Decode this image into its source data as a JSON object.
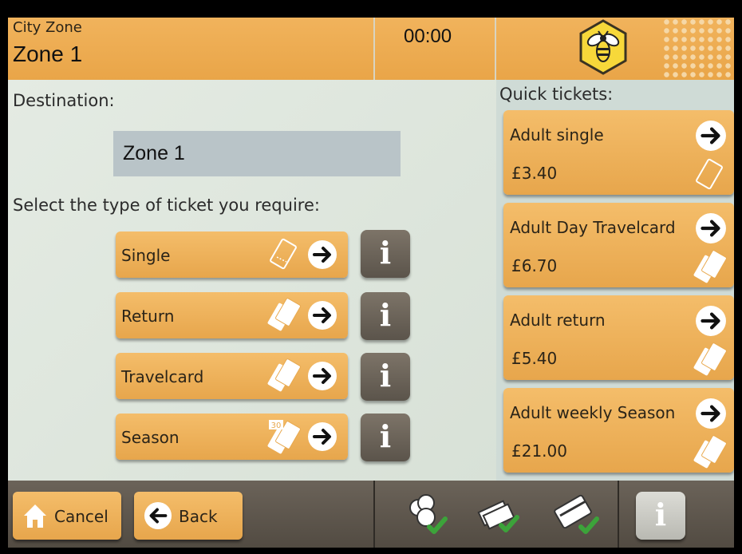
{
  "header": {
    "zone_label": "City Zone",
    "zone_value": "Zone 1",
    "clock": "00:00"
  },
  "destination": {
    "label": "Destination:",
    "value": "Zone 1"
  },
  "ticket_types": {
    "label": "Select the type of ticket you require:",
    "items": [
      {
        "label": "Single",
        "icon": "single-ticket-icon"
      },
      {
        "label": "Return",
        "icon": "return-ticket-icon"
      },
      {
        "label": "Travelcard",
        "icon": "travelcard-icon"
      },
      {
        "label": "Season",
        "icon": "season-ticket-icon",
        "badge": "30"
      }
    ],
    "info_glyph": "i"
  },
  "quick_tickets": {
    "label": "Quick tickets:",
    "items": [
      {
        "name": "Adult single",
        "price": "£3.40"
      },
      {
        "name": "Adult Day Travelcard",
        "price": "£6.70"
      },
      {
        "name": "Adult return",
        "price": "£5.40"
      },
      {
        "name": "Adult weekly Season",
        "price": "£21.00"
      }
    ]
  },
  "footer": {
    "cancel_label": "Cancel",
    "back_label": "Back",
    "payment_icons": [
      "coins-accepted-icon",
      "notes-accepted-icon",
      "card-accepted-icon"
    ],
    "info_glyph": "i"
  },
  "colors": {
    "button_orange": "#efb35f",
    "panel_bg": "#dfe7de",
    "info_button": "#6b6359",
    "accept_green": "#3ca33a"
  }
}
